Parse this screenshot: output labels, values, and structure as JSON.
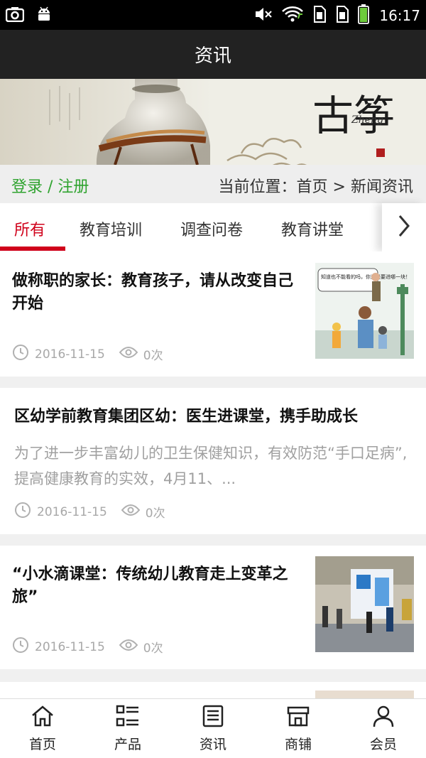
{
  "status_bar": {
    "time": "16:17",
    "icons": [
      "camera-icon",
      "android-icon",
      "mute-icon",
      "wifi-icon",
      "sim1-icon",
      "sim2-icon",
      "battery-icon"
    ]
  },
  "header": {
    "title": "资讯"
  },
  "banner": {
    "logo_text": "古筝",
    "logo_pinyin": "Zheng"
  },
  "auth": {
    "login": "登录",
    "separator": " / ",
    "register": "注册"
  },
  "location": {
    "label": "当前位置：",
    "home": "首页",
    "arrow": " > ",
    "current": "新闻资讯"
  },
  "tabs": {
    "items": [
      {
        "label": "所有",
        "active": true
      },
      {
        "label": "教育培训",
        "active": false
      },
      {
        "label": "调查问卷",
        "active": false
      },
      {
        "label": "教育讲堂",
        "active": false
      }
    ]
  },
  "news": [
    {
      "title": "做称职的家长：教育孩子，请从改变自己开始",
      "date": "2016-11-15",
      "views": "0次",
      "thumb_caption": "知道也不能看的吗，你这是要进哪一块！"
    },
    {
      "title": "区幼学前教育集团区幼：医生进课堂，携手助成长",
      "summary": "为了进一步丰富幼儿的卫生保健知识，有效防范“手口足病”,提高健康教育的实效，4月11、...",
      "date": "2016-11-15",
      "views": "0次"
    },
    {
      "title": "“小水滴课堂：传统幼儿教育走上变革之旅”",
      "date": "2016-11-15",
      "views": "0次"
    }
  ],
  "bottom_nav": [
    {
      "label": "首页",
      "icon": "home-icon"
    },
    {
      "label": "产品",
      "icon": "product-list-icon"
    },
    {
      "label": "资讯",
      "icon": "news-icon"
    },
    {
      "label": "商铺",
      "icon": "shop-icon"
    },
    {
      "label": "会员",
      "icon": "member-icon"
    }
  ],
  "colors": {
    "accent_red": "#d0021b",
    "auth_green": "#2fa32f",
    "title_bar": "#222222"
  }
}
